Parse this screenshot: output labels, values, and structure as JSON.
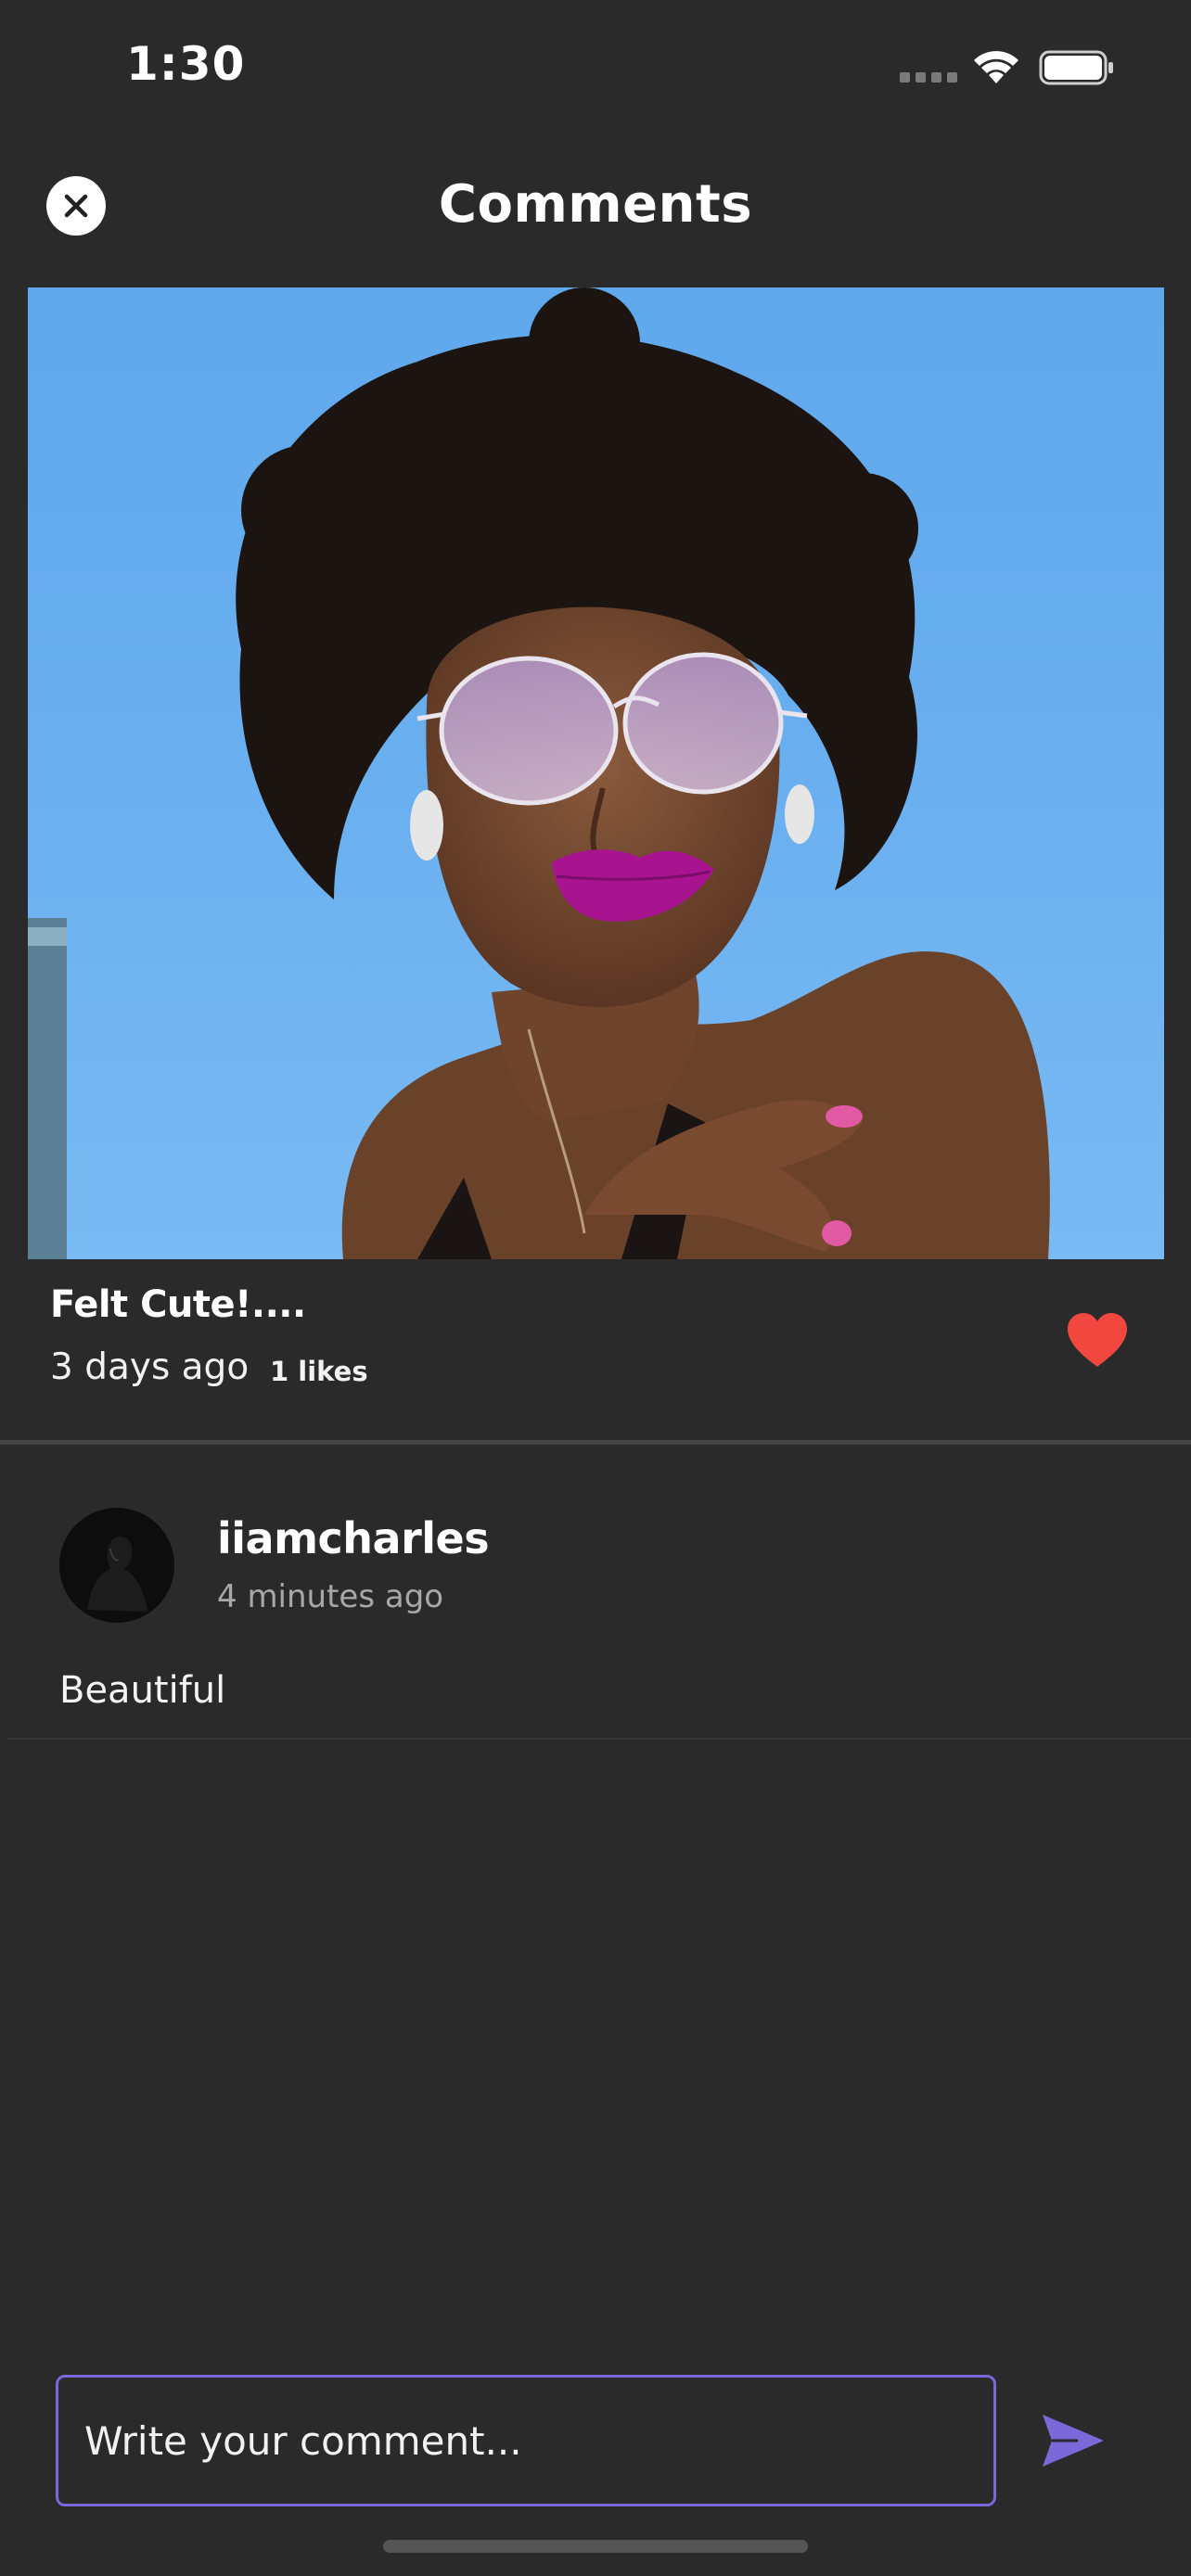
{
  "status_bar": {
    "time": "1:30"
  },
  "header": {
    "title": "Comments",
    "close_icon": "close-icon"
  },
  "post": {
    "caption": "Felt Cute!....",
    "time_ago": "3 days ago",
    "likes": "1 likes",
    "liked": true,
    "heart_color": "#f2473f"
  },
  "comments": [
    {
      "username": "iiamcharles",
      "time_ago": "4 minutes ago",
      "text": "Beautiful"
    }
  ],
  "composer": {
    "placeholder": "Write your comment...",
    "value": "",
    "send_icon": "send-icon"
  },
  "colors": {
    "background": "#2a2a2a",
    "accent": "#7b68d9",
    "divider": "#444444"
  }
}
